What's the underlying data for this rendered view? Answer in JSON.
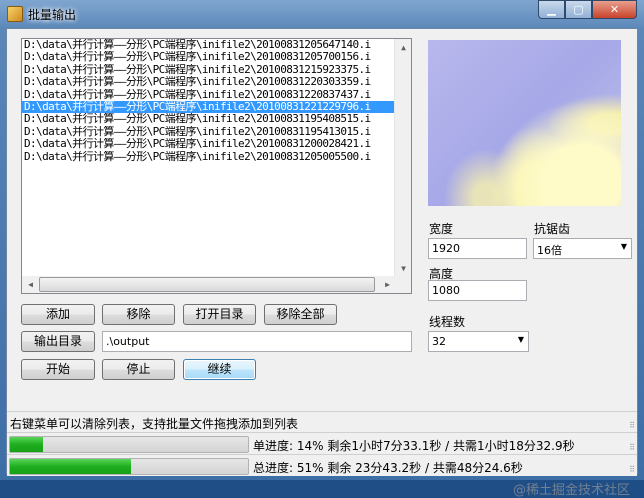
{
  "window": {
    "title": "批量输出",
    "controls": [
      "minimize",
      "maximize",
      "close"
    ]
  },
  "file_list": {
    "items": [
      "D:\\data\\并行计算——分形\\PC端程序\\inifile2\\20100831205647140.i",
      "D:\\data\\并行计算——分形\\PC端程序\\inifile2\\20100831205700156.i",
      "D:\\data\\并行计算——分形\\PC端程序\\inifile2\\20100831215923375.i",
      "D:\\data\\并行计算——分形\\PC端程序\\inifile2\\20100831220303359.i",
      "D:\\data\\并行计算——分形\\PC端程序\\inifile2\\20100831220837437.i",
      "D:\\data\\并行计算——分形\\PC端程序\\inifile2\\20100831221229796.i",
      "D:\\data\\并行计算——分形\\PC端程序\\inifile2\\20100831195408515.i",
      "D:\\data\\并行计算——分形\\PC端程序\\inifile2\\20100831195413015.i",
      "D:\\data\\并行计算——分形\\PC端程序\\inifile2\\20100831200028421.i",
      "D:\\data\\并行计算——分形\\PC端程序\\inifile2\\20100831205005500.i"
    ],
    "selected_index": 5
  },
  "settings": {
    "width_label": "宽度",
    "width_value": "1920",
    "aa_label": "抗锯齿",
    "aa_value": "16倍",
    "height_label": "高度",
    "height_value": "1080",
    "threads_label": "线程数",
    "threads_value": "32"
  },
  "buttons": {
    "add": "添加",
    "remove": "移除",
    "open_dir": "打开目录",
    "remove_all": "移除全部",
    "output_dir": "输出目录",
    "start": "开始",
    "stop": "停止",
    "continue": "继续"
  },
  "output_path": ".\\output",
  "status": {
    "hint": "右键菜单可以清除列表，支持批量文件拖拽添加到列表",
    "single_progress": 14,
    "single_text": "单进度: 14% 剩余1小时7分33.1秒 / 共需1小时18分32.9秒",
    "total_progress": 51,
    "total_text": "总进度: 51% 剩余 23分43.2秒 / 共需48分24.6秒"
  },
  "watermark": "@稀土掘金技术社区"
}
